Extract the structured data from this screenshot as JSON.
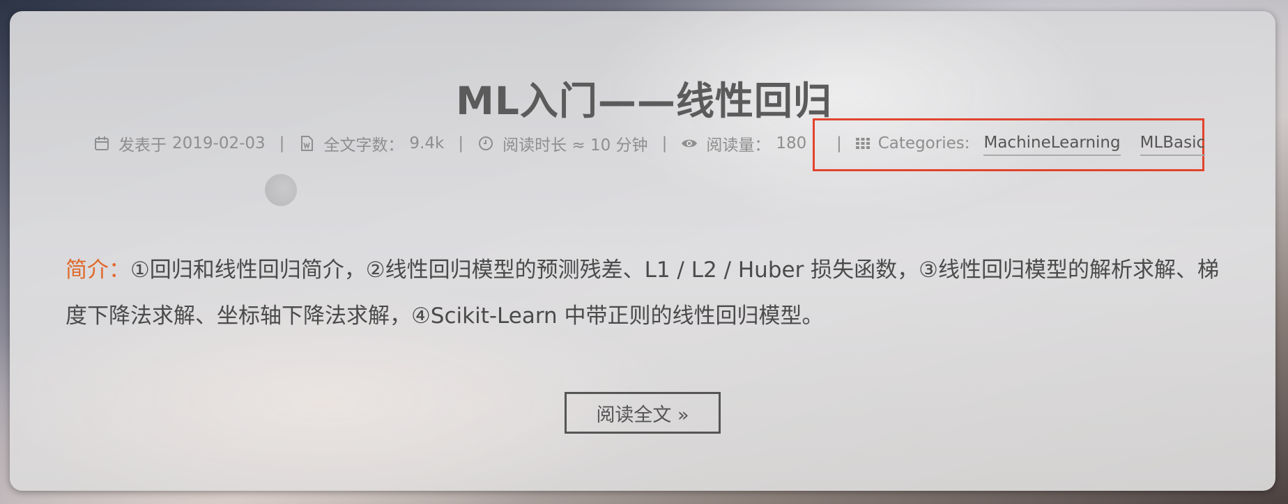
{
  "post": {
    "title": "ML入门——线性回归",
    "meta": {
      "published_label": "发表于",
      "published_date": "2019-02-03",
      "word_count_label": "全文字数：",
      "word_count": "9.4k",
      "read_time": "阅读时长 ≈ 10 分钟",
      "views_label": "阅读量：",
      "views": "180",
      "separator": "|"
    },
    "categories": {
      "label": "Categories:",
      "items": [
        "MachineLearning",
        "MLBasic"
      ]
    },
    "summary": {
      "label": "简介：",
      "text": "①回归和线性回归简介，②线性回归模型的预测残差、L1 / L2 / Huber 损失函数，③线性回归模型的解析求解、梯度下降法求解、坐标轴下降法求解，④Scikit-Learn 中带正则的线性回归模型。"
    },
    "read_more_label": "阅读全文 »"
  },
  "colors": {
    "title": "#5b5b5b",
    "meta": "#8e8e8e",
    "summary_label": "#e0692c",
    "highlight_box": "#e2432d"
  },
  "icons": [
    "calendar-icon",
    "file-word-icon",
    "clock-icon",
    "eye-icon",
    "grid-icon"
  ]
}
